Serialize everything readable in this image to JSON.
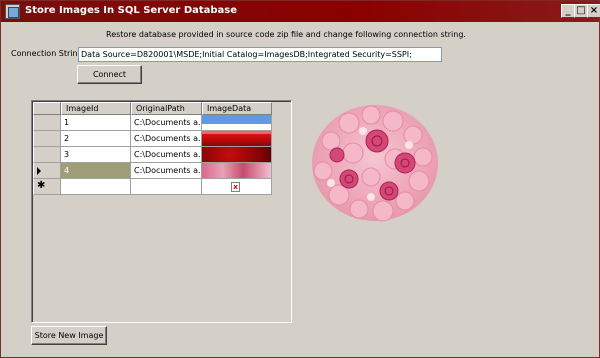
{
  "window": {
    "title": "Store Images In SQL Server Database",
    "minimize": "_",
    "maximize": "□",
    "close": "×"
  },
  "instruction": "Restore database provided in source code zip file and change following connection string.",
  "connection": {
    "label": "Connection String :",
    "value": "Data Source=D820001\\MSDE;Initial Catalog=ImagesDB;Integrated Security=SSPI;",
    "connect_label": "Connect"
  },
  "grid": {
    "columns": [
      "ImageId",
      "OriginalPath",
      "ImageData"
    ],
    "rows": [
      {
        "id": "1",
        "path": "C:\\Documents a..."
      },
      {
        "id": "2",
        "path": "C:\\Documents a..."
      },
      {
        "id": "3",
        "path": "C:\\Documents a..."
      },
      {
        "id": "4",
        "path": "C:\\Documents a..."
      }
    ],
    "new_row_marker": "✱",
    "broken_image": "x"
  },
  "store_label": "Store New Image",
  "colors": {
    "titlebar": "#8b0000",
    "window_bg": "#d4d0c8",
    "selected_cell": "#a09e78"
  }
}
